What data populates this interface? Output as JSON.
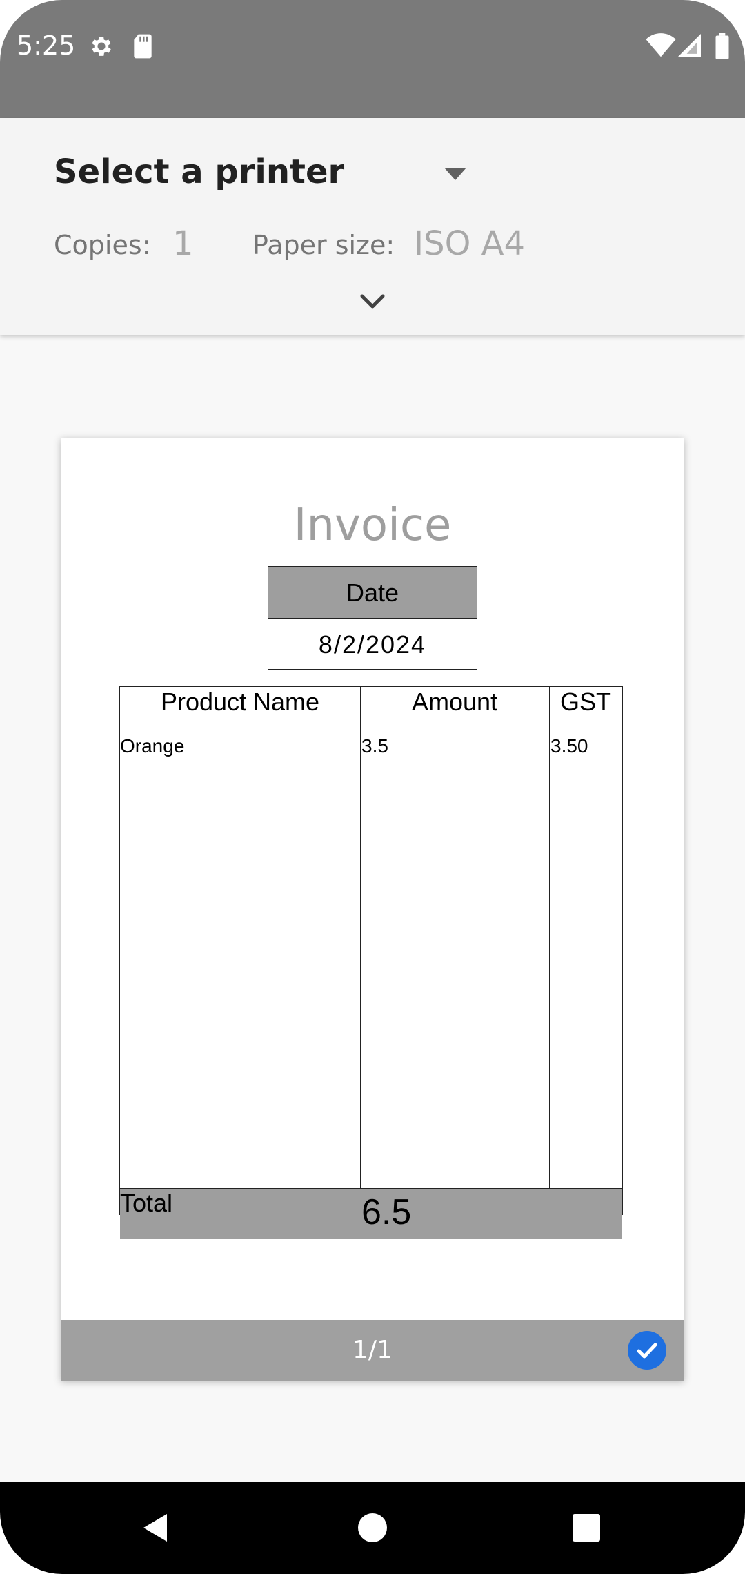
{
  "status_bar": {
    "time": "5:25",
    "left_icons": [
      "gear-icon",
      "sd-card-icon"
    ],
    "right_icons": [
      "wifi-icon",
      "cell-signal-icon",
      "battery-icon"
    ]
  },
  "print_options": {
    "printer_label": "Select a printer",
    "copies_label": "Copies:",
    "copies_value": "1",
    "paper_size_label": "Paper size:",
    "paper_size_value": "ISO A4"
  },
  "preview": {
    "title": "Invoice",
    "date_header": "Date",
    "date_value": "8/2/2024",
    "table": {
      "headers": [
        "Product Name",
        "Amount",
        "GST"
      ],
      "rows": [
        [
          "Orange",
          "3.5",
          "3.50"
        ]
      ],
      "total_label": "Total",
      "total_value": "6.5"
    },
    "page_counter": "1/1",
    "page_selected": true
  },
  "nav_bar": {
    "buttons": [
      "back-icon",
      "home-icon",
      "recents-icon"
    ]
  },
  "colors": {
    "status_bar": "#7a7a7a",
    "header_bg": "#f4f4f4",
    "accent_check": "#1e6fe0",
    "table_fill": "#9e9e9e"
  }
}
